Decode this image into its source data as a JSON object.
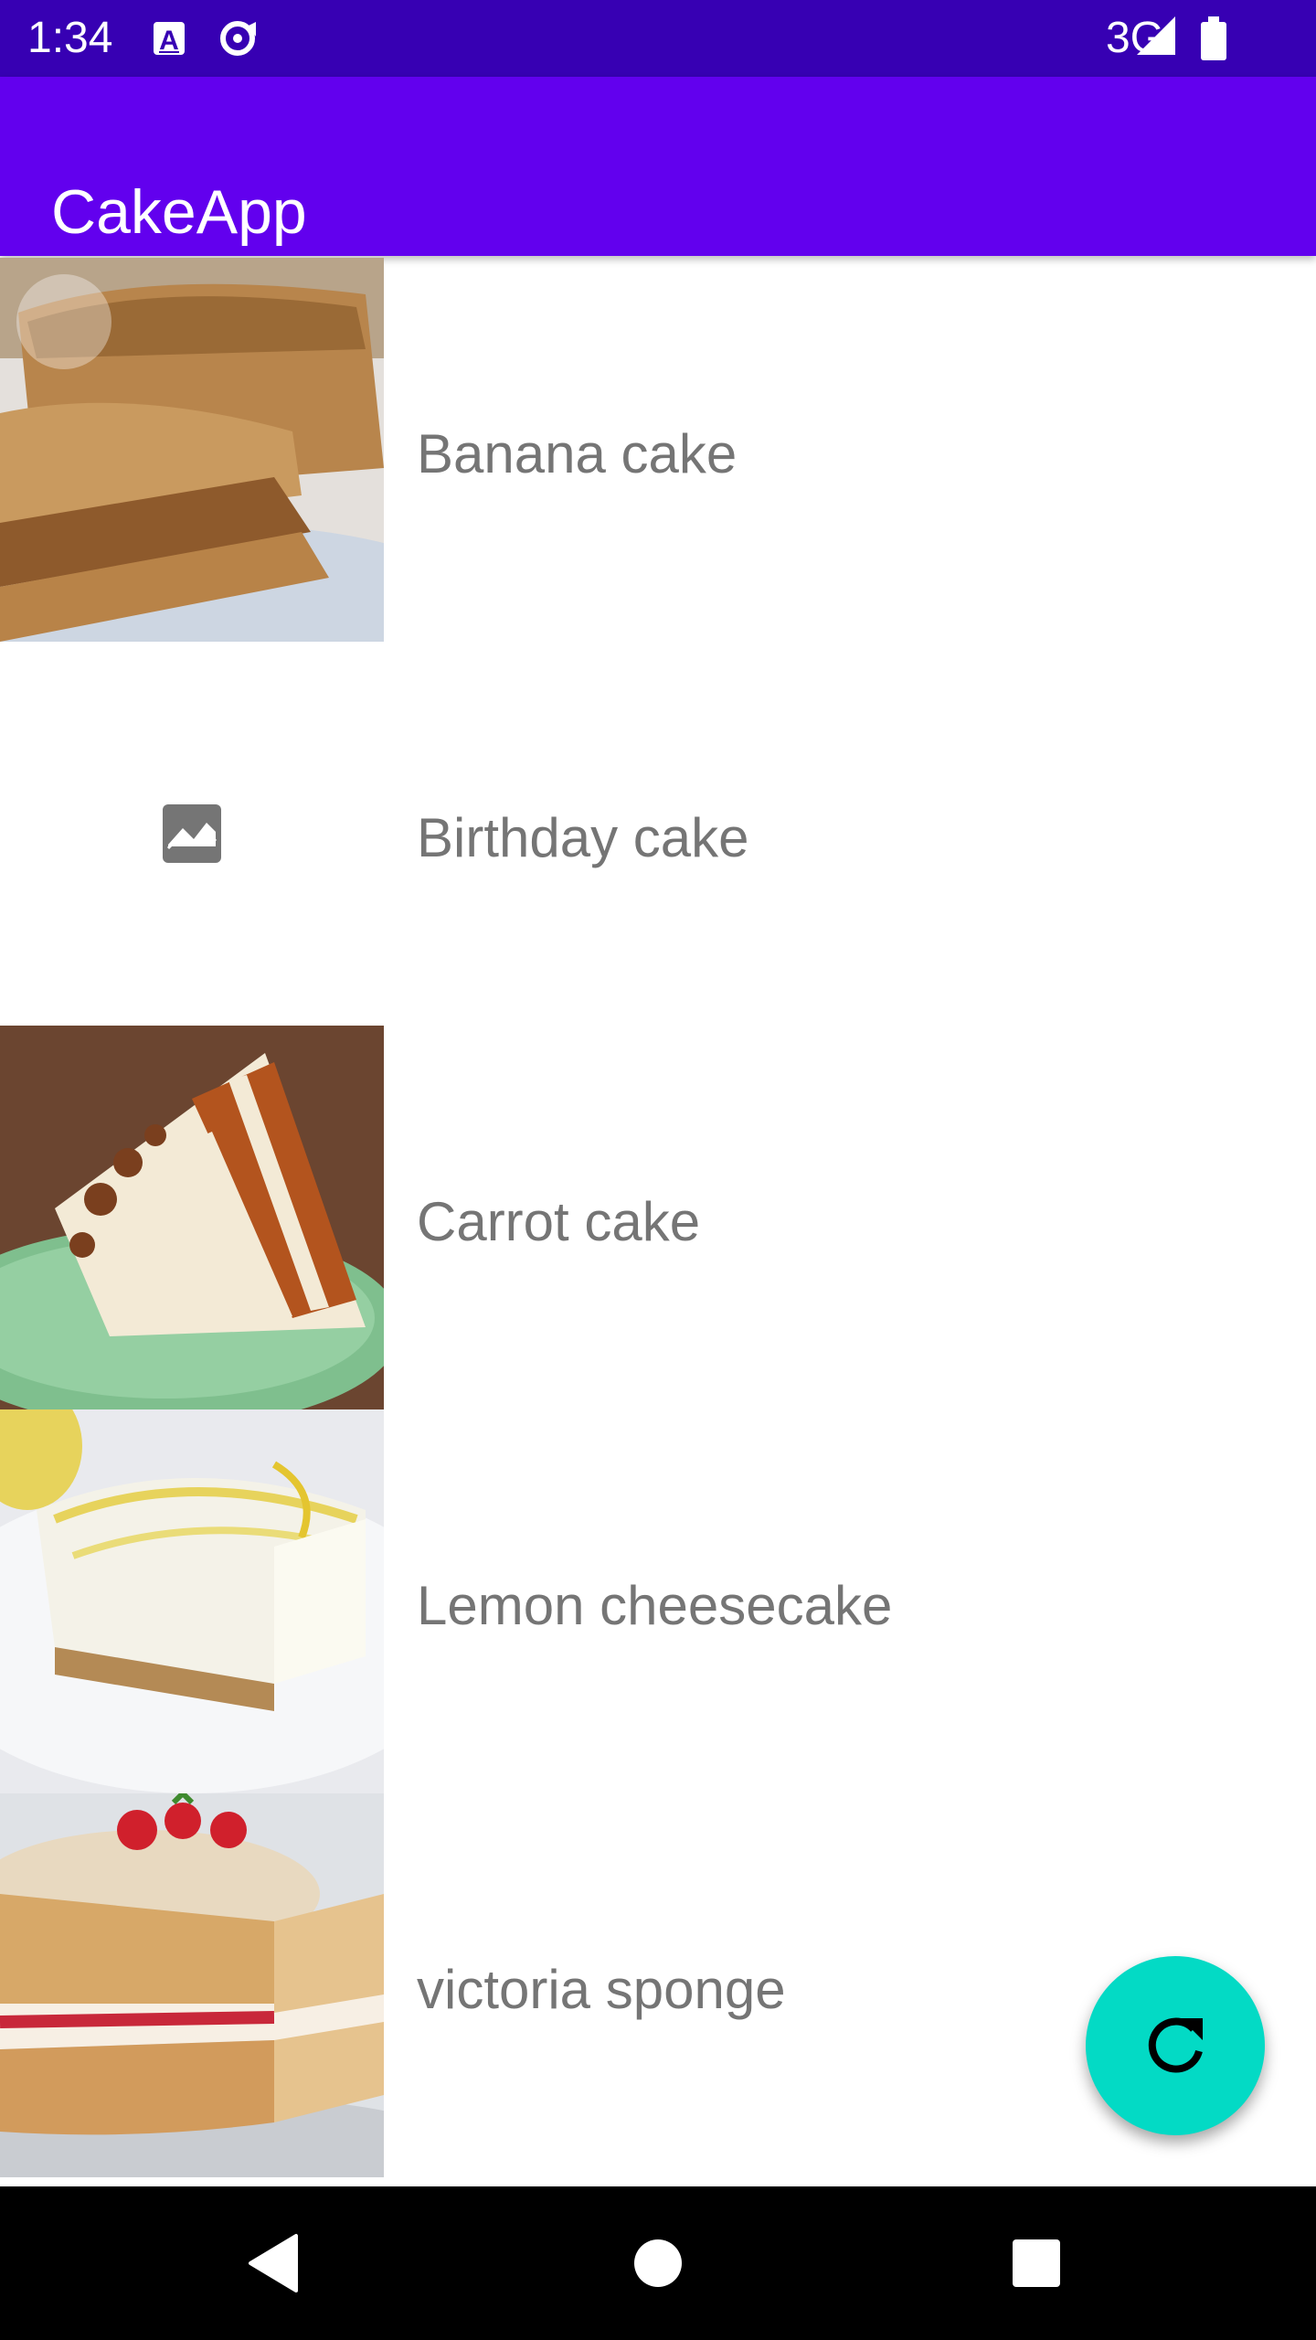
{
  "status_bar": {
    "time": "1:34",
    "network": "3G",
    "icons": [
      "font-icon",
      "data-saver-icon",
      "signal-icon",
      "battery-icon"
    ]
  },
  "app_bar": {
    "title": "CakeApp"
  },
  "cakes": [
    {
      "name": "Banana cake",
      "image": "banana-cake-photo"
    },
    {
      "name": "Birthday cake",
      "image": "broken-image-icon"
    },
    {
      "name": "Carrot cake",
      "image": "carrot-cake-photo"
    },
    {
      "name": "Lemon cheesecake",
      "image": "lemon-cheesecake-photo"
    },
    {
      "name": "victoria sponge",
      "image": "victoria-sponge-photo"
    }
  ],
  "fab": {
    "icon": "refresh-icon"
  },
  "nav_bar": {
    "icons": [
      "back-icon",
      "home-icon",
      "recents-icon"
    ]
  },
  "colors": {
    "status_bar": "#3700b3",
    "app_bar": "#6200ee",
    "fab": "#03dac5",
    "label_text": "#757575"
  }
}
